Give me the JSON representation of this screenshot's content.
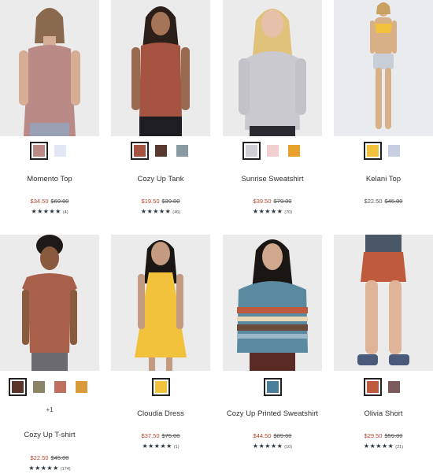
{
  "products": [
    {
      "name": "Momento Top",
      "photo_alt": "woman in pink tank top",
      "swatches": [
        "#b98a86",
        "#e3e6f4"
      ],
      "selected": 0,
      "sale_price": "$34.50",
      "orig_price": "$69.00",
      "stars": "★★★★★",
      "reviews": "(4)"
    },
    {
      "name": "Cozy Up Tank",
      "photo_alt": "woman in rust tank",
      "swatches": [
        "#a45440",
        "#5a3a2e",
        "#8a9aa2"
      ],
      "selected": 0,
      "sale_price": "$19.50",
      "orig_price": "$39.00",
      "stars": "★★★★★",
      "reviews": "(46)"
    },
    {
      "name": "Sunrise Sweatshirt",
      "photo_alt": "woman in grey sweatshirt",
      "swatches": [
        "#d0d0d4",
        "#f2d0d0",
        "#e8a22c"
      ],
      "selected": 0,
      "sale_price": "$39.50",
      "orig_price": "$79.00",
      "stars": "★★★★★",
      "reviews": "(70)"
    },
    {
      "name": "Kelani Top",
      "photo_alt": "woman in yellow swim top",
      "swatches": [
        "#f1c13b",
        "#c9cfe3"
      ],
      "selected": 0,
      "sale_price": "$22.50",
      "orig_price": "$45.00",
      "stars": "",
      "reviews": ""
    },
    {
      "name": "Cozy Up T-shirt",
      "photo_alt": "woman in rust t-shirt",
      "swatches": [
        "#5a342a",
        "#8a8468",
        "#c07060",
        "#d99a3a"
      ],
      "selected": 0,
      "more": "+1",
      "sale_price": "$22.50",
      "orig_price": "$45.00",
      "stars": "★★★★★",
      "reviews": "(174)"
    },
    {
      "name": "Cloudia Dress",
      "photo_alt": "woman in yellow dress",
      "swatches": [
        "#f2c23c"
      ],
      "selected": 0,
      "sale_price": "$37.50",
      "orig_price": "$75.00",
      "stars": "★★★★★",
      "reviews": "(1)"
    },
    {
      "name": "Cozy Up Printed Sweatshirt",
      "photo_alt": "woman in printed sweatshirt",
      "swatches": [
        "#4a7f9c"
      ],
      "selected": 0,
      "sale_price": "$44.50",
      "orig_price": "$89.00",
      "stars": "★★★★★",
      "reviews": "(10)"
    },
    {
      "name": "Olivia Short",
      "photo_alt": "person in rust shorts",
      "swatches": [
        "#c05a3c",
        "#7a5a5a"
      ],
      "selected": 0,
      "sale_price": "$29.50",
      "orig_price": "$59.00",
      "stars": "★★★★★",
      "reviews": "(21)"
    }
  ],
  "colors": {
    "sale": "#b1452e",
    "stars": "#2a3540",
    "photo_bg": "#ebebeb"
  }
}
